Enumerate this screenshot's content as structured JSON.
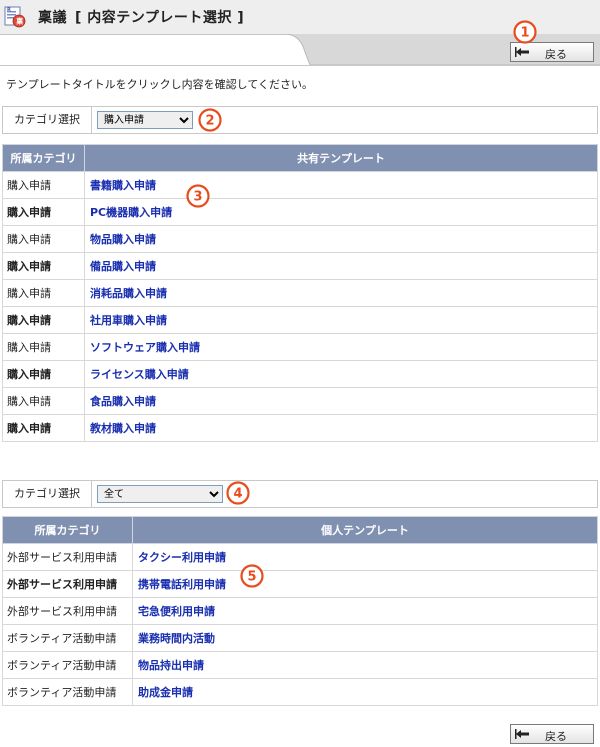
{
  "header": {
    "title": "稟議",
    "subtitle": "[ 内容テンプレート選択 ]",
    "back_label": "戻る"
  },
  "instructions": "テンプレートタイトルをクリックし内容を確認してください。",
  "shared_section": {
    "category_label": "カテゴリ選択",
    "category_selected": "購入申請",
    "columns": [
      "所属カテゴリ",
      "共有テンプレート"
    ],
    "rows": [
      {
        "category": "購入申請",
        "template": "書籍購入申請"
      },
      {
        "category": "購入申請",
        "template": "PC機器購入申請"
      },
      {
        "category": "購入申請",
        "template": "物品購入申請"
      },
      {
        "category": "購入申請",
        "template": "備品購入申請"
      },
      {
        "category": "購入申請",
        "template": "消耗品購入申請"
      },
      {
        "category": "購入申請",
        "template": "社用車購入申請"
      },
      {
        "category": "購入申請",
        "template": "ソフトウェア購入申請"
      },
      {
        "category": "購入申請",
        "template": "ライセンス購入申請"
      },
      {
        "category": "購入申請",
        "template": "食品購入申請"
      },
      {
        "category": "購入申請",
        "template": "教材購入申請"
      }
    ]
  },
  "personal_section": {
    "category_label": "カテゴリ選択",
    "category_selected": "全て",
    "columns": [
      "所属カテゴリ",
      "個人テンプレート"
    ],
    "rows": [
      {
        "category": "外部サービス利用申請",
        "template": "タクシー利用申請"
      },
      {
        "category": "外部サービス利用申請",
        "template": "携帯電話利用申請"
      },
      {
        "category": "外部サービス利用申請",
        "template": "宅急便利用申請"
      },
      {
        "category": "ボランティア活動申請",
        "template": "業務時間内活動"
      },
      {
        "category": "ボランティア活動申請",
        "template": "物品持出申請"
      },
      {
        "category": "ボランティア活動申請",
        "template": "助成金申請"
      }
    ]
  },
  "badges": [
    "1",
    "2",
    "3",
    "4",
    "5"
  ],
  "colors": {
    "header_row": "#8090b0",
    "link": "#1a2fb0",
    "badge": "#e84c1c"
  }
}
